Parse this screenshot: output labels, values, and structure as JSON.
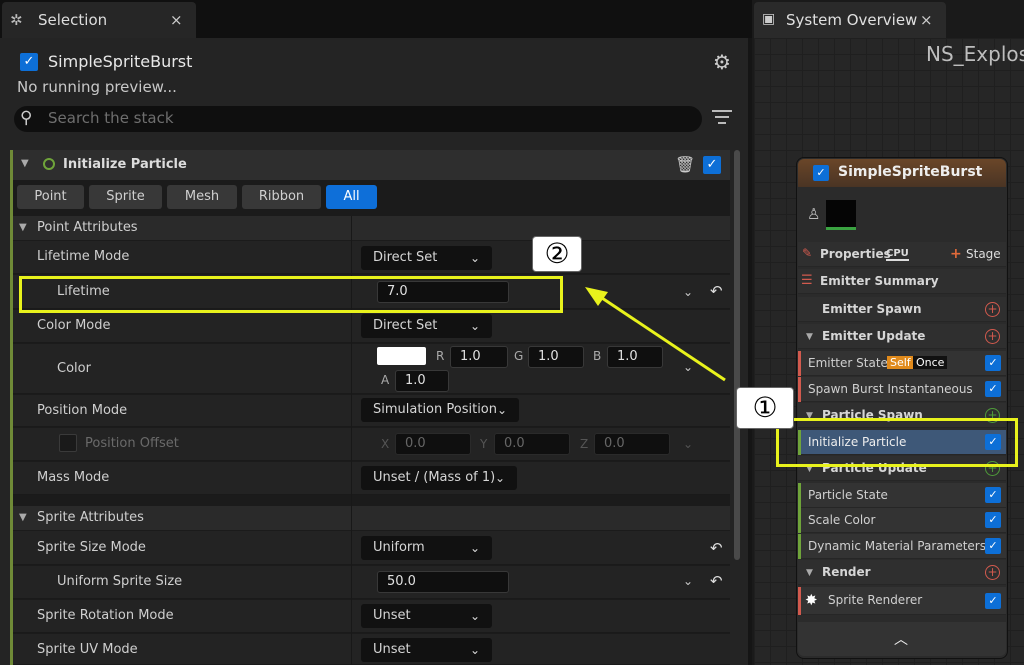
{
  "selection_tab": {
    "title": "Selection",
    "icon": "stars-icon",
    "close": "×"
  },
  "emitter": {
    "name": "SimpleSpriteBurst",
    "status": "No running preview..."
  },
  "search": {
    "placeholder": "Search the stack"
  },
  "module": {
    "title": "Initialize Particle"
  },
  "filter_tabs": [
    {
      "label": "Point"
    },
    {
      "label": "Sprite"
    },
    {
      "label": "Mesh"
    },
    {
      "label": "Ribbon"
    },
    {
      "label": "All",
      "active": true
    }
  ],
  "sections": {
    "point": "Point Attributes",
    "sprite": "Sprite Attributes"
  },
  "props": {
    "lifetime_mode": {
      "label": "Lifetime Mode",
      "value": "Direct Set"
    },
    "lifetime": {
      "label": "Lifetime",
      "value": "7.0"
    },
    "color_mode": {
      "label": "Color Mode",
      "value": "Direct Set"
    },
    "color": {
      "label": "Color",
      "r": "1.0",
      "g": "1.0",
      "b": "1.0",
      "a": "1.0",
      "swatch": "#ffffff"
    },
    "position_mode": {
      "label": "Position Mode",
      "value": "Simulation Position"
    },
    "position_offset": {
      "label": "Position Offset",
      "x": "0.0",
      "y": "0.0",
      "z": "0.0"
    },
    "mass_mode": {
      "label": "Mass Mode",
      "value": "Unset / (Mass of 1)"
    },
    "sprite_size_mode": {
      "label": "Sprite Size Mode",
      "value": "Uniform"
    },
    "uniform_sprite_size": {
      "label": "Uniform Sprite Size",
      "value": "50.0"
    },
    "sprite_rotation_mode": {
      "label": "Sprite Rotation Mode",
      "value": "Unset"
    },
    "sprite_uv_mode": {
      "label": "Sprite UV Mode",
      "value": "Unset"
    }
  },
  "axes": {
    "r": "R",
    "g": "G",
    "b": "B",
    "a": "A",
    "x": "X",
    "y": "Y",
    "z": "Z"
  },
  "annotations": {
    "one": "①",
    "two": "②",
    "highlight_color": "#e8f21c"
  },
  "overview_tab": {
    "title": "System Overview",
    "close": "×"
  },
  "graph": {
    "title": "NS_Explos"
  },
  "node": {
    "name": "SimpleSpriteBurst",
    "properties": "Properties",
    "cpu": "CPU",
    "stage": "Stage",
    "emitter_summary": "Emitter Summary",
    "emitter_spawn": "Emitter Spawn",
    "emitter_update": "Emitter Update",
    "emitter_state": "Emitter State",
    "self_tag": "Self",
    "once_tag": "Once",
    "spawn_burst": "Spawn Burst Instantaneous",
    "particle_spawn": "Particle Spawn",
    "initialize_particle": "Initialize Particle",
    "particle_update": "Particle Update",
    "particle_state": "Particle State",
    "scale_color": "Scale Color",
    "dynamic_material": "Dynamic Material Parameters",
    "render": "Render",
    "sprite_renderer": "Sprite Renderer"
  },
  "colors": {
    "accent": "#0d6fd7",
    "module_stripe": "#6f8a37",
    "highlight": "#e8f21c",
    "node_header": "#6a4628"
  }
}
